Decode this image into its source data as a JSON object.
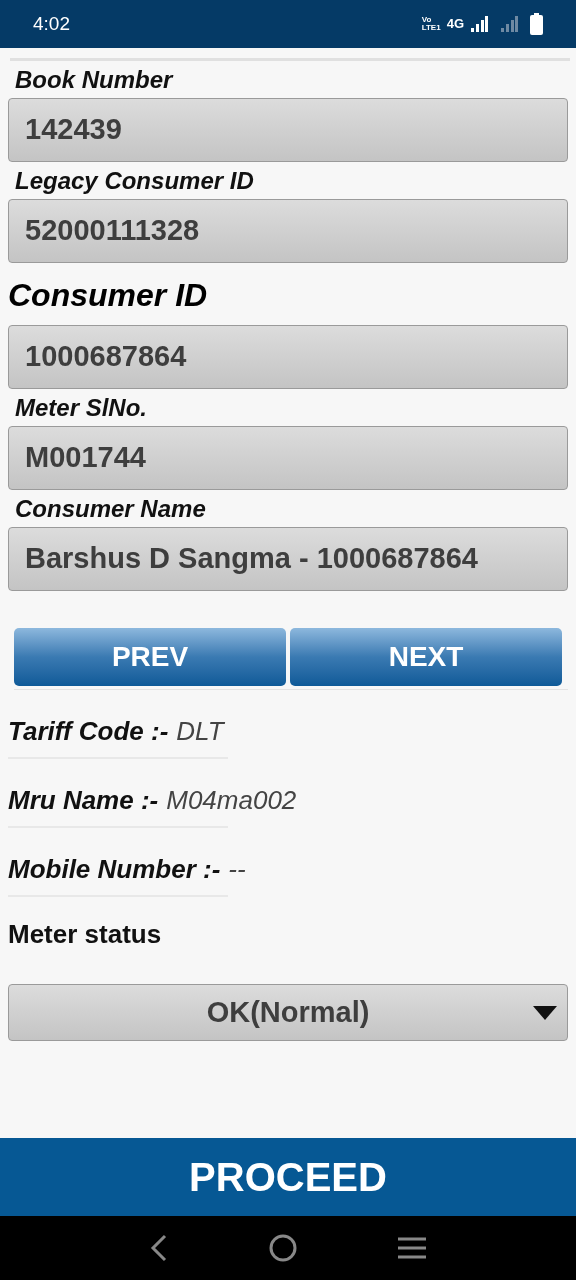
{
  "status_bar": {
    "time": "4:02",
    "volte": [
      "Vo",
      "LTE1"
    ],
    "network": "4G"
  },
  "fields": [
    {
      "label": "Book Number",
      "value": "142439",
      "emphasis": false
    },
    {
      "label": "Legacy Consumer ID",
      "value": "52000111328",
      "emphasis": false
    },
    {
      "label": "Consumer ID",
      "value": "1000687864",
      "emphasis": true
    },
    {
      "label": "Meter SlNo.",
      "value": "M001744",
      "emphasis": false
    },
    {
      "label": "Consumer Name",
      "value": "Barshus D Sangma - 1000687864",
      "emphasis": false
    }
  ],
  "buttons": [
    "PREV",
    "NEXT"
  ],
  "info": [
    {
      "label": "Tariff Code :-",
      "value": "DLT"
    },
    {
      "label": "Mru Name :-",
      "value": "M04ma002"
    },
    {
      "label": "Mobile Number :-",
      "value": "--"
    }
  ],
  "meter_status": {
    "label": "Meter status",
    "value": "OK(Normal)"
  },
  "proceed": "PROCEED"
}
